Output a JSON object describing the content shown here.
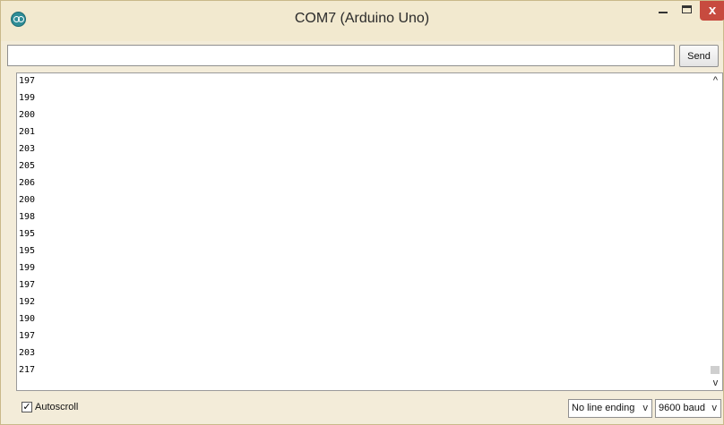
{
  "window": {
    "title": "COM7 (Arduino Uno)",
    "app_icon": "arduino-icon",
    "controls": {
      "minimize": "–",
      "maximize": "□",
      "close": "x"
    }
  },
  "send_bar": {
    "input_value": "",
    "send_label": "Send"
  },
  "output": {
    "lines": [
      "197",
      "199",
      "200",
      "201",
      "203",
      "205",
      "206",
      "200",
      "198",
      "195",
      "195",
      "199",
      "197",
      "192",
      "190",
      "197",
      "203",
      "217"
    ]
  },
  "scrollbar": {
    "up_arrow": "^",
    "down_arrow": "v"
  },
  "bottom_bar": {
    "autoscroll_label": "Autoscroll",
    "autoscroll_checked": true,
    "check_mark": "✓",
    "line_ending": "No line ending",
    "baud_rate": "9600 baud",
    "dropdown_arrow": "v"
  },
  "colors": {
    "window_bg": "#f3ecd9",
    "close_button": "#c74b3f",
    "icon_teal": "#2f8d97"
  }
}
